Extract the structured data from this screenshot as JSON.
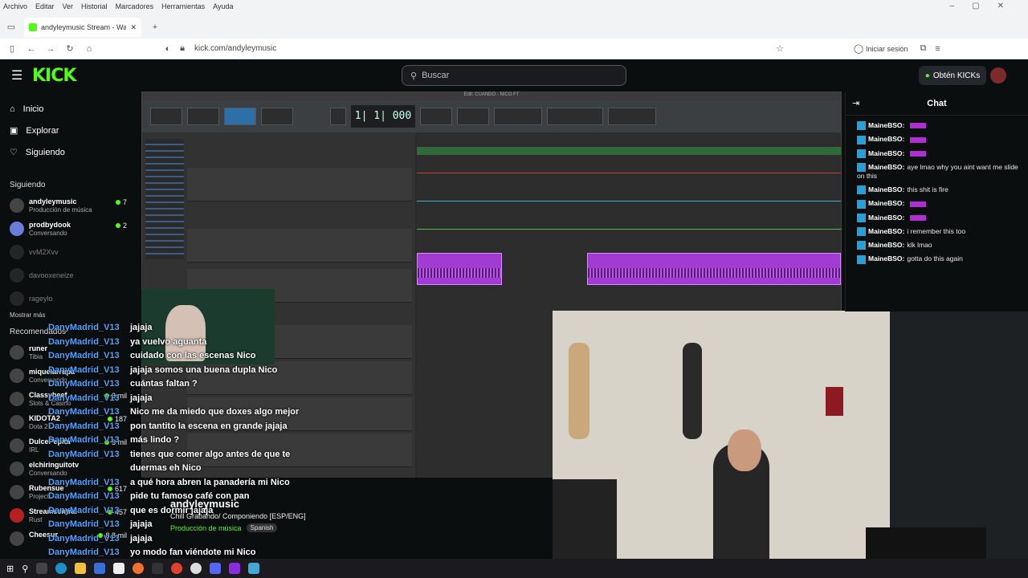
{
  "browser": {
    "menu": [
      "Archivo",
      "Editar",
      "Ver",
      "Historial",
      "Marcadores",
      "Herramientas",
      "Ayuda"
    ],
    "tab_title": "andyleymusic Stream - Watch",
    "url": "kick.com/andyleymusic",
    "signin": "Iniciar sesión"
  },
  "header": {
    "logo": "KICK",
    "search_placeholder": "Buscar",
    "kicks_button": "Obtén KICKs"
  },
  "sidebar": {
    "nav": [
      {
        "label": "Inicio",
        "icon": "home-icon"
      },
      {
        "label": "Explorar",
        "icon": "compass-icon"
      },
      {
        "label": "Siguiendo",
        "icon": "heart-icon"
      }
    ],
    "following_title": "Siguiendo",
    "following": [
      {
        "name": "andyleymusic",
        "sub": "Producción de música",
        "viewers": "7"
      },
      {
        "name": "prodbydook",
        "sub": "Conversando",
        "viewers": "2"
      },
      {
        "name": "vvM2Xvv",
        "sub": "",
        "viewers": ""
      },
      {
        "name": "davooxeneize",
        "sub": "",
        "viewers": ""
      },
      {
        "name": "rageylo",
        "sub": "",
        "viewers": ""
      }
    ],
    "show_more": "Mostrar más",
    "recommended_title": "Recomendados",
    "recommended": [
      {
        "name": "runer",
        "sub": "Tibia",
        "viewers": ""
      },
      {
        "name": "miquelarrupa",
        "sub": "Conversando",
        "viewers": ""
      },
      {
        "name": "Classybeef",
        "sub": "Slots & Casino",
        "viewers": "3 mil"
      },
      {
        "name": "KIDOTA2",
        "sub": "Dota 2",
        "viewers": "187"
      },
      {
        "name": "DulcePepita",
        "sub": "IRL",
        "viewers": "3 mil"
      },
      {
        "name": "elchiringuitotv",
        "sub": "Conversando",
        "viewers": ""
      },
      {
        "name": "Rubensue",
        "sub": "Project",
        "viewers": "617"
      },
      {
        "name": "Streamcentral",
        "sub": "Rust",
        "viewers": "457"
      },
      {
        "name": "Cheesur",
        "sub": "",
        "viewers": "8.8 mil"
      }
    ]
  },
  "daw": {
    "title": "Edit: CUANDO - NICO FT",
    "counter": "1| 1| 000"
  },
  "overlay_chat": [
    {
      "user": "DanyMadrid_V13",
      "text": "jajaja"
    },
    {
      "user": "DanyMadrid_V13",
      "text": "ya vuelvo aguanta"
    },
    {
      "user": "DanyMadrid_V13",
      "text": "cuidado con las escenas Nico"
    },
    {
      "user": "DanyMadrid_V13",
      "text": "jajaja somos una buena dupla Nico"
    },
    {
      "user": "DanyMadrid_V13",
      "text": "cuántas faltan ?"
    },
    {
      "user": "DanyMadrid_V13",
      "text": "jajaja"
    },
    {
      "user": "DanyMadrid_V13",
      "text": "Nico me da miedo que doxes algo mejor"
    },
    {
      "user": "DanyMadrid_V13",
      "text": "pon tantito la escena en grande jajaja"
    },
    {
      "user": "DanyMadrid_V13",
      "text": "más lindo ?"
    },
    {
      "user": "DanyMadrid_V13",
      "text": "tienes que comer algo antes de que te"
    },
    {
      "user": "",
      "text": "duermas eh Nico"
    },
    {
      "user": "DanyMadrid_V13",
      "text": "a qué hora abren la panadería mi Nico"
    },
    {
      "user": "DanyMadrid_V13",
      "text": "pide tu famoso café con pan"
    },
    {
      "user": "DanyMadrid_V13",
      "text": "que es dormir jajaja"
    },
    {
      "user": "DanyMadrid_V13",
      "text": "jajaja"
    },
    {
      "user": "DanyMadrid_V13",
      "text": "jajaja"
    },
    {
      "user": "DanyMadrid_V13",
      "text": "yo modo fan viéndote mi Nico"
    }
  ],
  "stream": {
    "channel": "andyleymusic",
    "title": "Chill Grabando/ Componiendo [ESP/ENG]",
    "category": "Producción de música",
    "tag": "Spanish"
  },
  "chat": {
    "title": "Chat",
    "messages": [
      {
        "user": "MaineBSO:",
        "text": "",
        "emote": true
      },
      {
        "user": "MaineBSO:",
        "text": "",
        "emote": true
      },
      {
        "user": "MaineBSO:",
        "text": "",
        "emote": true
      },
      {
        "user": "MaineBSO:",
        "text": "aye lmao why you aint want me slide on this",
        "emote": false
      },
      {
        "user": "MaineBSO:",
        "text": "this shit is fire",
        "emote": false
      },
      {
        "user": "MaineBSO:",
        "text": "",
        "emote": true
      },
      {
        "user": "MaineBSO:",
        "text": "",
        "emote": true
      },
      {
        "user": "MaineBSO:",
        "text": "i remember this too",
        "emote": false
      },
      {
        "user": "MaineBSO:",
        "text": "klk lmao",
        "emote": false
      },
      {
        "user": "MaineBSO:",
        "text": "gotta do this again",
        "emote": false
      }
    ]
  },
  "colors": {
    "accent": "#53fc18",
    "clip": "#a23bd1",
    "overlay_user": "#4fa3ff"
  }
}
